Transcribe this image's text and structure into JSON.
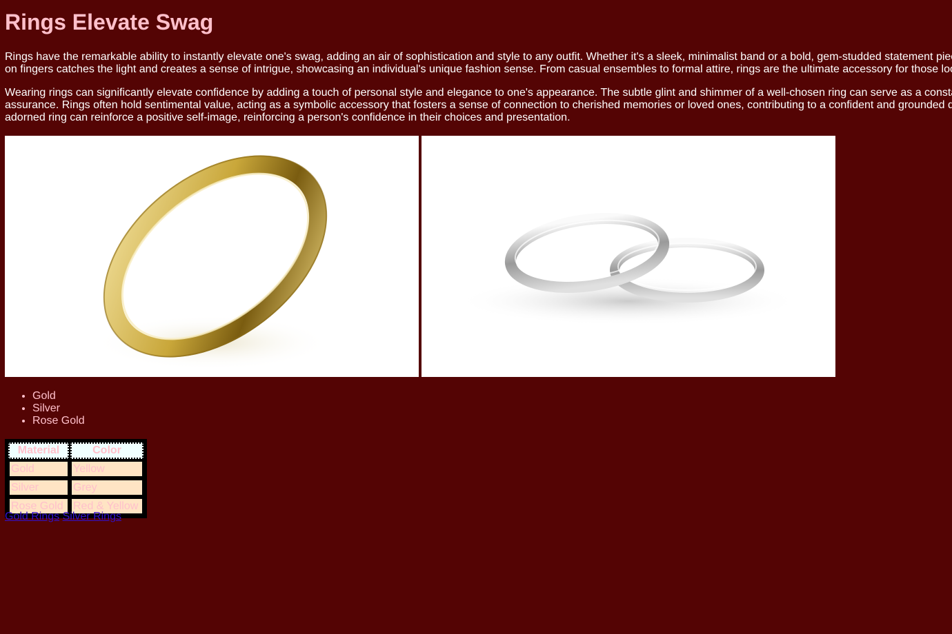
{
  "page": {
    "title": "Rings Elevate Swag",
    "background": "#540404",
    "heading_color": "#ffc0cb"
  },
  "paragraphs": [
    {
      "lines": [
        "Rings have the remarkable ability to instantly elevate one's swag, adding an air of sophistication and style to any outfit. Whether it's a sleek, minimalist band or a bold, gem-studded statement piece",
        "on fingers catches the light and creates a sense of intrigue, showcasing an individual's unique fashion sense. From casual ensembles to formal attire, rings are the ultimate accessory for those looking"
      ]
    },
    {
      "lines": [
        "Wearing rings can significantly elevate confidence by adding a touch of personal style and elegance to one's appearance. The subtle glint and shimmer of a well-chosen ring can serve as a constant",
        "assurance. Rings often hold sentimental value, acting as a symbolic accessory that fosters a sense of connection to cherished memories or loved ones, contributing to a confident and grounded d",
        "adorned ring can reinforce a positive self-image, reinforcing a person's confidence in their choices and presentation."
      ]
    }
  ],
  "images": [
    {
      "subject": "gold-ring",
      "color": "#d8b850"
    },
    {
      "subject": "silver-rings",
      "color": "#c8c8c8"
    }
  ],
  "materials": [
    "Gold",
    "Silver",
    "Rose Gold"
  ],
  "table": {
    "headers": [
      "Material",
      "Color"
    ],
    "rows": [
      [
        "Gold",
        "Yellow"
      ],
      [
        "Silver",
        "Grey"
      ],
      [
        "Rose Gold",
        "Red & Yellow"
      ]
    ]
  },
  "links": [
    "Gold Rings",
    "Silver Rings"
  ]
}
